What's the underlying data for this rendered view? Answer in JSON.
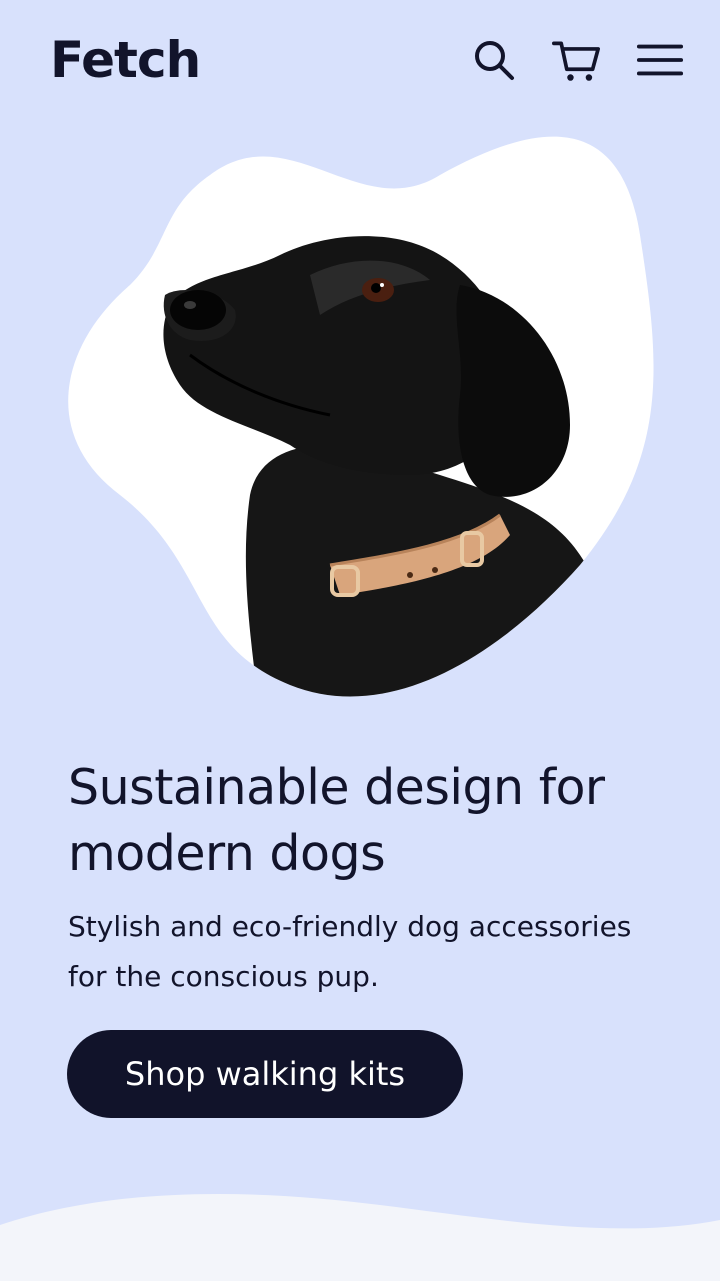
{
  "brand": {
    "name": "Fetch"
  },
  "header": {
    "icons": [
      "search-icon",
      "cart-icon",
      "menu-icon"
    ]
  },
  "hero": {
    "headline": "Sustainable design for modern dogs",
    "subtext": "Stylish and eco-friendly dog accessories for the conscious pup.",
    "cta_label": "Shop walking kits"
  },
  "colors": {
    "background": "#d8e1fc",
    "ink": "#12142b",
    "button": "#11132a",
    "button_text": "#ffffff",
    "footer_wave": "#f3f5fa",
    "collar": "#d9a57c"
  }
}
